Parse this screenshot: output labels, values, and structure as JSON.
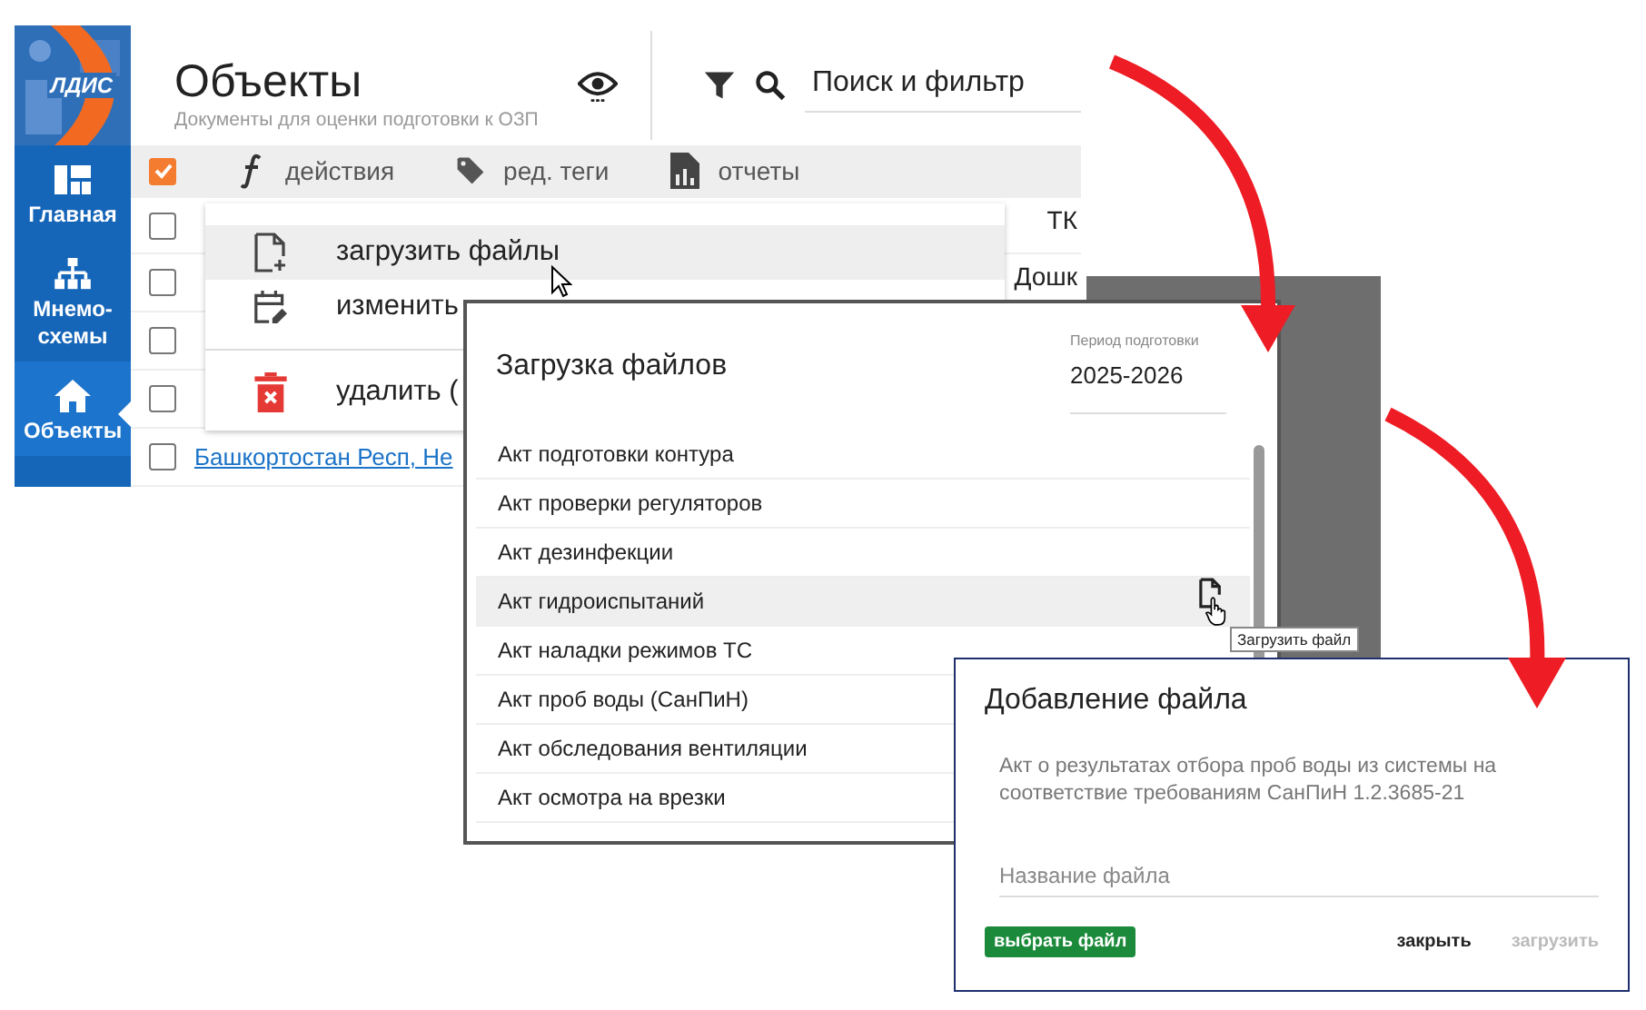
{
  "logo": {
    "text": "ЛДИС"
  },
  "sidebar": {
    "items": [
      {
        "label": "Главная",
        "kind": "dashboard",
        "selected": false
      },
      {
        "label": "Мнемо-схемы",
        "kind": "hierarchy",
        "selected": false
      },
      {
        "label": "Объекты",
        "kind": "home",
        "selected": true
      }
    ]
  },
  "header": {
    "title": "Объекты",
    "subtitle": "Документы для оценки подготовки к ОЗП",
    "search": {
      "value": "Поиск и фильтр"
    }
  },
  "toolbar": {
    "checked": true,
    "actions": [
      {
        "label": "действия",
        "kind": "function"
      },
      {
        "label": "ред. теги",
        "kind": "tag"
      },
      {
        "label": "отчеты",
        "kind": "report"
      }
    ]
  },
  "rows": [
    {
      "checked": false,
      "trailing": "ТК"
    },
    {
      "checked": false,
      "trailing": "Дошк"
    },
    {
      "checked": false
    },
    {
      "checked": false
    },
    {
      "checked": false,
      "link": "Башкортостан Респ, Не"
    }
  ],
  "menu": {
    "items": [
      {
        "label": "загрузить файлы",
        "kind": "upload",
        "highlighted": true
      },
      {
        "label": "изменить",
        "kind": "edit",
        "highlighted": false
      },
      {
        "label": "удалить (",
        "kind": "delete",
        "highlighted": false
      }
    ]
  },
  "upload_dialog": {
    "title": "Загрузка файлов",
    "period_label": "Период подготовки",
    "period_value": "2025-2026",
    "tooltip": "Загрузить файл",
    "items": [
      {
        "label": "Акт подготовки контура",
        "highlighted": false
      },
      {
        "label": "Акт проверки регуляторов",
        "highlighted": false
      },
      {
        "label": "Акт дезинфекции",
        "highlighted": false
      },
      {
        "label": "Акт гидроиспытаний",
        "highlighted": true
      },
      {
        "label": "Акт наладки режимов ТС",
        "highlighted": false
      },
      {
        "label": "Акт проб воды (СанПиН)",
        "highlighted": false
      },
      {
        "label": "Акт обследования вентиляции",
        "highlighted": false
      },
      {
        "label": "Акт осмотра на врезки",
        "highlighted": false
      }
    ]
  },
  "add_file_dialog": {
    "title": "Добавление файла",
    "description": "Акт о результатах отбора проб воды из системы на соответствие требованиям СанПиН 1.2.3685-21",
    "file_name": {
      "placeholder": "Название файла"
    },
    "buttons": [
      {
        "label": "выбрать файл",
        "kind": "primary",
        "disabled": false
      },
      {
        "label": "закрыть",
        "kind": "text",
        "disabled": false
      },
      {
        "label": "загрузить",
        "kind": "text",
        "disabled": true
      }
    ]
  }
}
